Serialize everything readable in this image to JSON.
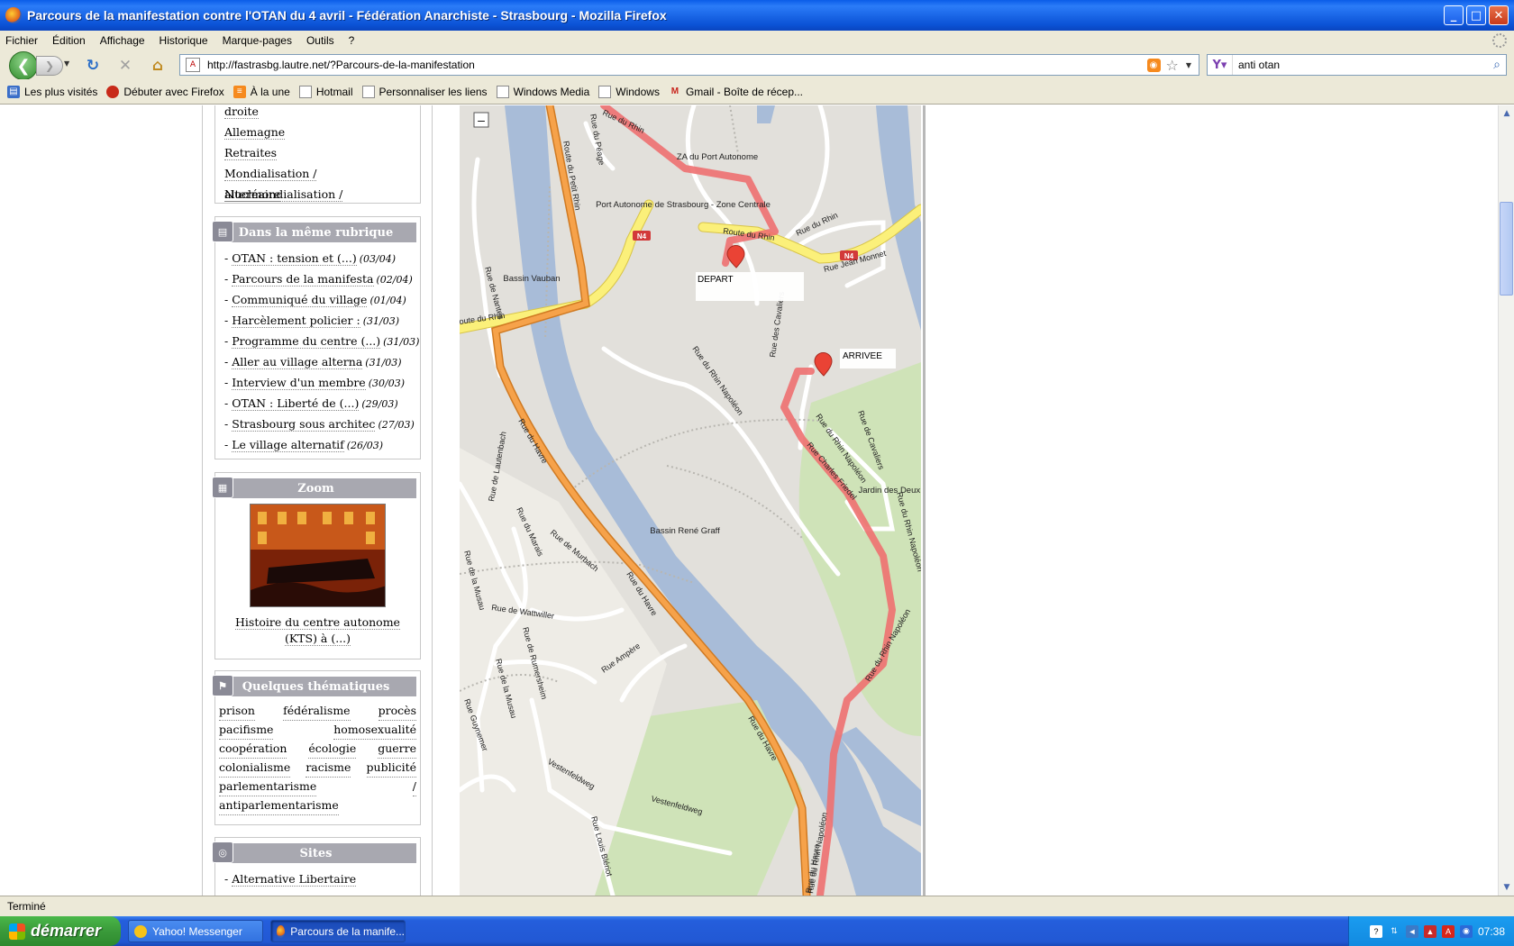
{
  "window": {
    "title": "Parcours de la manifestation contre l'OTAN du 4 avril - Fédération Anarchiste - Strasbourg - Mozilla Firefox",
    "buttons": {
      "minimize": "_",
      "maximize": "□",
      "close": "✕"
    }
  },
  "menu": [
    "Fichier",
    "Édition",
    "Affichage",
    "Historique",
    "Marque-pages",
    "Outils",
    "?"
  ],
  "nav": {
    "url": "http://fastrasbg.lautre.net/?Parcours-de-la-manifestation",
    "search_query": "anti otan"
  },
  "bookmarks": [
    {
      "label": "Les plus visités",
      "icon": "blue"
    },
    {
      "label": "Débuter avec Firefox",
      "icon": "ff"
    },
    {
      "label": "À la une",
      "icon": "rss"
    },
    {
      "label": "Hotmail",
      "icon": "page"
    },
    {
      "label": "Personnaliser les liens",
      "icon": "page"
    },
    {
      "label": "Windows Media",
      "icon": "page"
    },
    {
      "label": "Windows",
      "icon": "page"
    },
    {
      "label": "Gmail - Boîte de récep...",
      "icon": "gmail"
    }
  ],
  "sidebar": {
    "top_links": [
      "droite",
      "Allemagne",
      "Retraites",
      "Mondialisation / altermondialisation /",
      "Nucléaire"
    ],
    "rubrique": {
      "title": "Dans la même rubrique",
      "items": [
        {
          "label": "OTAN : tension et (...)",
          "date": "(03/04)"
        },
        {
          "label": "Parcours de la manifesta",
          "date": "(02/04)"
        },
        {
          "label": "Communiqué du village",
          "date": "(01/04)"
        },
        {
          "label": "Harcèlement policier :",
          "date": "(31/03)"
        },
        {
          "label": "Programme du centre (...)",
          "date": "(31/03)"
        },
        {
          "label": "Aller au village alterna",
          "date": "(31/03)"
        },
        {
          "label": "Interview d'un membre",
          "date": "(30/03)"
        },
        {
          "label": "OTAN : Liberté de (...)",
          "date": "(29/03)"
        },
        {
          "label": "Strasbourg sous architec",
          "date": "(27/03)"
        },
        {
          "label": "Le village alternatif",
          "date": "(26/03)"
        }
      ]
    },
    "zoom": {
      "title": "Zoom",
      "caption": "Histoire du centre autonome (KTS) à (...)"
    },
    "themes": {
      "title": "Quelques thématiques",
      "rows": [
        [
          "prison",
          "fédéralisme",
          "procès"
        ],
        [
          "pacifisme",
          "homosexualité"
        ],
        [
          "coopération",
          "écologie",
          "guerre"
        ],
        [
          "colonialisme",
          "racisme",
          "publicité"
        ],
        [
          "parlementarisme",
          "/"
        ],
        [
          "antiparlementarisme"
        ]
      ]
    },
    "sites": {
      "title": "Sites",
      "items": [
        "Alternative Libertaire"
      ]
    }
  },
  "map": {
    "labels": {
      "rue_du_rhin": "Rue du Rhin",
      "rue_du_peage": "Rue du Péage",
      "za_port": "ZA du Port Autonome",
      "port_autonome": "Port Autonome de Strasbourg - Zone Centrale",
      "route_du_rhin": "Route du Rhin",
      "route_du_petit_rhin": "Route du Petit Rhin",
      "route_du_rhin_left": "oute du Rhin",
      "route_du_rhin_right": "Route du Rhin",
      "n4": "N4",
      "rue_jean_monnet": "Rue Jean Monnet",
      "bassin_vauban": "Bassin Vauban",
      "rue_de_nantes": "Rue de Nantes",
      "rue_des_cavaliers": "Rue des Cavaliers",
      "rue_du_rhin_napoleon": "Rue du Rhin Napoléon",
      "rue_de_cavaliers2": "Rue de Cavaliers",
      "rue_du_havre": "Rue du Havre",
      "rue_charles_friedel": "Rue Charles Friedel",
      "jardin": "Jardin des Deux Rives",
      "bassin_rene_graff": "Bassin René Graff",
      "rue_de_murbach": "Rue de Murbach",
      "rue_du_marais": "Rue du Marais",
      "rue_de_lautenbach": "Rue de Lautenbach",
      "rue_de_la_musau": "Rue de la Musau",
      "rue_de_wattwiller": "Rue de Wattwiller",
      "rue_de_rumersheim": "Rue de Rumersheim",
      "rue_ampere": "Rue Ampère",
      "rue_gutenberg": "Rue Guynemer",
      "vestenfeldweg": "Vestenfeldweg",
      "rue_louis_blériot": "Rue Louis Blériot"
    },
    "markers": {
      "depart": "DEPART",
      "arrivee": "ARRIVEE"
    },
    "zoom_out": "–"
  },
  "status": "Terminé",
  "taskbar": {
    "start": "démarrer",
    "tasks": [
      "Yahoo! Messenger",
      "Parcours de la manife..."
    ],
    "clock": "07:38"
  }
}
